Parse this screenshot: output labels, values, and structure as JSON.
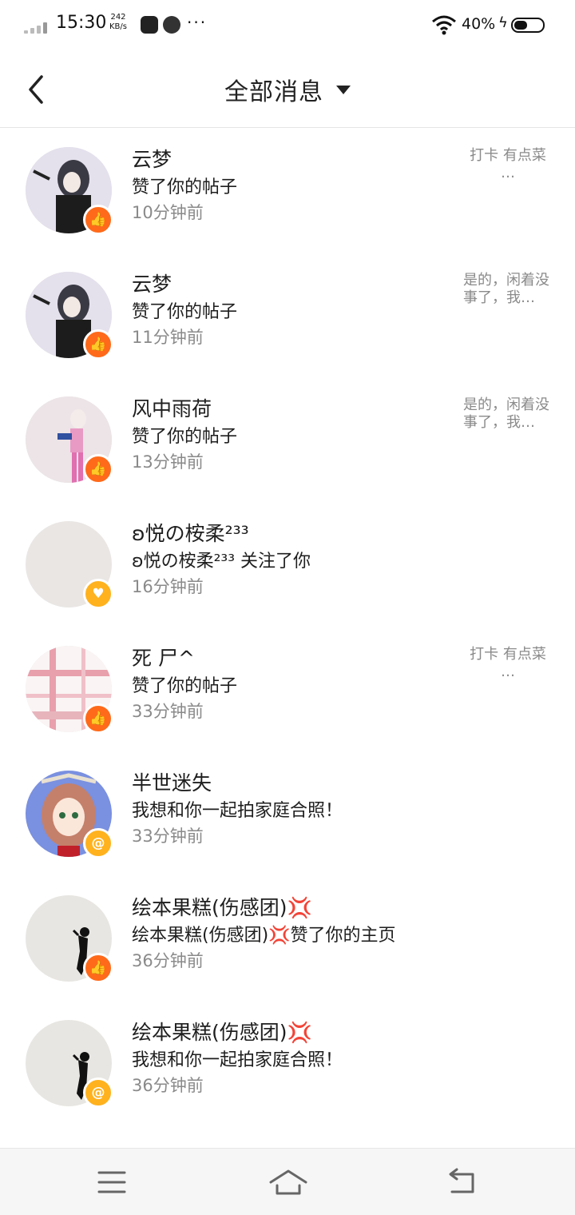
{
  "status_bar": {
    "time": "15:30",
    "speed_value": "242",
    "speed_unit": "KB/s",
    "battery": "40%"
  },
  "header": {
    "title": "全部消息"
  },
  "messages": [
    {
      "name": "云梦",
      "action": "赞了你的帖子",
      "time": "10分钟前",
      "preview": "打卡 有点菜 …",
      "badge": "like"
    },
    {
      "name": "云梦",
      "action": "赞了你的帖子",
      "time": "11分钟前",
      "preview": "是的，闲着没事了，我…",
      "badge": "like"
    },
    {
      "name": "风中雨荷",
      "action": "赞了你的帖子",
      "time": "13分钟前",
      "preview": "是的，闲着没事了，我…",
      "badge": "like"
    },
    {
      "name": "ʚ悦の桉柔²³³",
      "action": "ʚ悦の桉柔²³³ 关注了你",
      "time": "16分钟前",
      "preview": "",
      "badge": "follow"
    },
    {
      "name": "死 尸^",
      "action": "赞了你的帖子",
      "time": "33分钟前",
      "preview": "打卡 有点菜 …",
      "badge": "like"
    },
    {
      "name": "半世迷失",
      "action": "我想和你一起拍家庭合照！",
      "time": "33分钟前",
      "preview": "",
      "badge": "at"
    },
    {
      "name": "绘本果糕(伤感团)💢",
      "action": "绘本果糕(伤感团)💢赞了你的主页",
      "time": "36分钟前",
      "preview": "",
      "badge": "like"
    },
    {
      "name": "绘本果糕(伤感团)💢",
      "action": "我想和你一起拍家庭合照！",
      "time": "36分钟前",
      "preview": "",
      "badge": "at"
    }
  ],
  "badge_colors": {
    "like": "#ff6a1a",
    "follow": "#ffb21e",
    "at": "#ffb21e"
  },
  "icons": {
    "back": "chevron-left-icon",
    "menu": "menu-icon",
    "home": "home-icon",
    "return": "return-icon"
  }
}
